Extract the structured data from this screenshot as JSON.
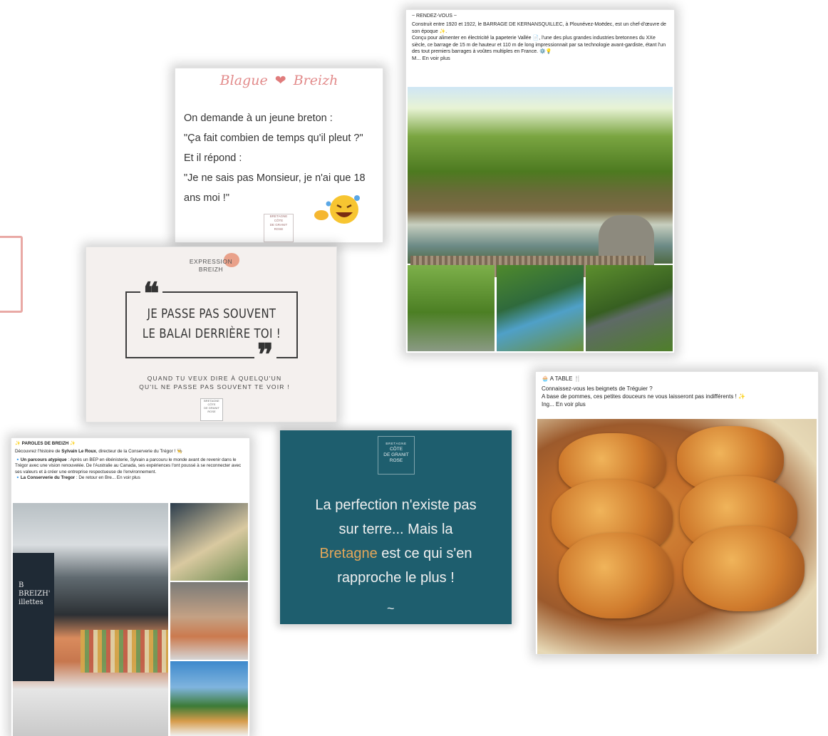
{
  "blague": {
    "title_left": "Blague",
    "title_right": "Breizh",
    "lines": [
      "On demande à un jeune breton :",
      "\"Ça fait combien de temps qu'il pleut ?\"",
      "Et il répond :",
      "\"Je ne sais pas Monsieur, je n'ai que 18",
      "ans moi !\""
    ],
    "logo_lines": [
      "BRETAGNE",
      "CÔTE",
      "DE GRANIT",
      "ROSE"
    ]
  },
  "expression": {
    "header_line1": "EXPRESSION",
    "header_line2": "BREIZH",
    "phrase_line1": "JE PASSE PAS SOUVENT",
    "phrase_line2": "LE BALAI DERRIÈRE TOI !",
    "open_quote": "❝",
    "close_quote": "❞",
    "meaning_line1": "QUAND TU VEUX DIRE À QUELQU'UN",
    "meaning_line2": "QU'IL NE PASSE PAS SOUVENT TE VOIR !",
    "logo_lines": [
      "BRETAGNE",
      "CÔTE",
      "DE GRANIT",
      "ROSE"
    ]
  },
  "rendezvous": {
    "heading": "~ RENDEZ-VOUS ~",
    "para1": "Construit entre 1920 et 1922, le BARRAGE DE KERNANSQUILLEC, à Plounévez-Moëdec, est un chef-d'œuvre de son époque ✨.",
    "para2": "Conçu pour alimenter en électricité la papeterie Vallée 📄, l'une des plus grandes industries bretonnes du XXe siècle, ce barrage de 15 m de hauteur et 110 m de long impressionnait par sa technologie avant-gardiste, étant l'un des tout premiers barrages à voûtes multiples en France. ⚙️💡",
    "more": "M... En voir plus"
  },
  "paroles": {
    "heading": "✨ PAROLES DE BREIZH ✨",
    "intro_prefix": "Découvrez l'histoire de ",
    "intro_name": "Sylvain Le Roux",
    "intro_suffix": ", directeur de la Conserverie du Trégor ! 👨‍🍳",
    "bullet1_title": "🔹Un parcours atypique",
    "bullet1_text": " : Après un BEP en ébénisterie, Sylvain a parcouru le monde avant de revenir dans le Trégor avec une vision renouvelée. De l'Australie au Canada, ses expériences l'ont poussé à se reconnecter avec ses valeurs et à créer une entreprise respectueuse de l'environnement.",
    "bullet2_title": "🔹La Conserverie du Tregor",
    "bullet2_text": " :  De retour en Bre... En voir plus",
    "bag_lines": [
      "B",
      "BREIZH'",
      "illettes"
    ]
  },
  "perfection": {
    "logo_lines": [
      "BRETAGNE",
      "CÔTE",
      "DE GRANIT",
      "ROSE"
    ],
    "line1": "La perfection n'existe pas",
    "line2": "sur terre... Mais la",
    "highlight": "Bretagne",
    "line3_rest": " est ce qui s'en",
    "line4": "rapproche le plus !",
    "wave": "~"
  },
  "table": {
    "heading": "🧁 A TABLE 🍴",
    "line1": "Connaissez-vous les beignets de Tréguier ?",
    "line2": "A base de pommes, ces petites douceurs ne vous laisseront pas indifférents ! ✨",
    "more": "Ing... En voir plus"
  },
  "colors": {
    "pink_accent": "#e28a8a",
    "teal_card": "#1e5e6e",
    "highlight_orange": "#e3a75a"
  }
}
